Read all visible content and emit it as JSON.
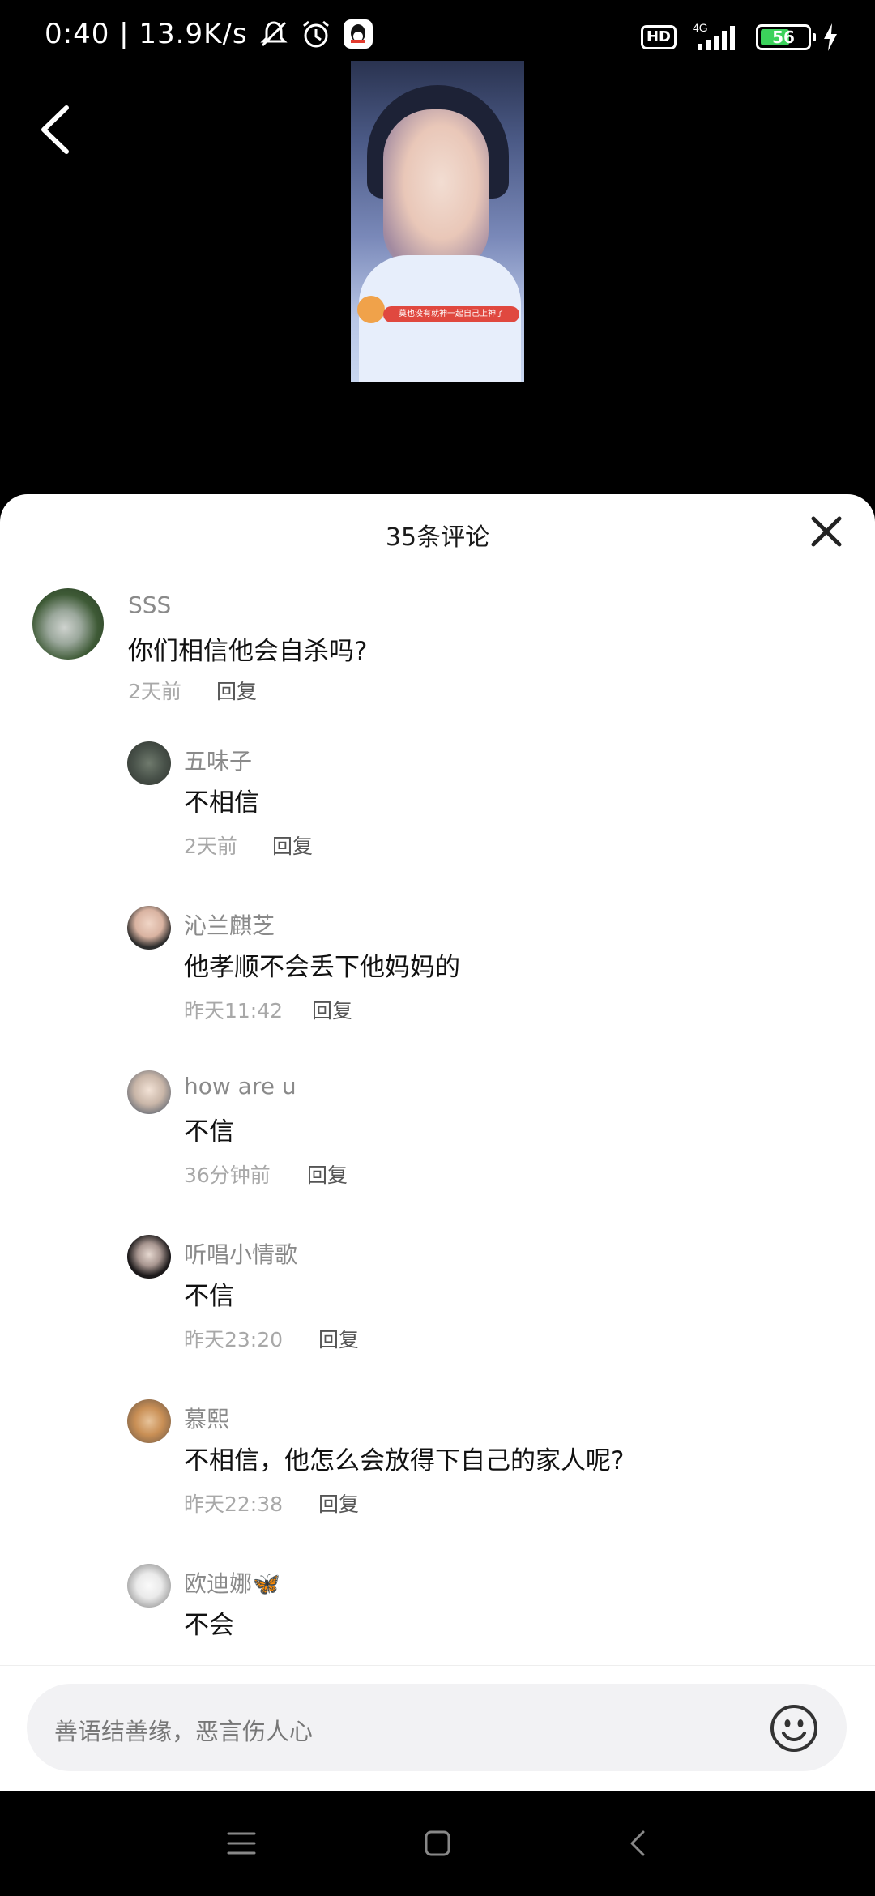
{
  "status_bar": {
    "time_speed": "0:40 | 13.9K/s",
    "hd": "HD",
    "network": "4G",
    "battery": "56"
  },
  "video": {
    "caption": "莫也没有就神一起自己上神了"
  },
  "sheet": {
    "title": "35条评论",
    "reply_label": "回复"
  },
  "comments": [
    {
      "user": "SSS",
      "text": "你们相信他会自杀吗?",
      "time": "2天前",
      "reply": "回复"
    },
    {
      "user": "五味子",
      "text": "不相信",
      "time": "2天前",
      "reply": "回复"
    },
    {
      "user": "沁兰麒芝",
      "text": "他孝顺不会丢下他妈妈的",
      "time": "昨天11:42",
      "reply": "回复"
    },
    {
      "user": "how are u",
      "text": "不信",
      "time": "36分钟前",
      "reply": "回复"
    },
    {
      "user": "听唱小情歌",
      "text": "不信",
      "time": "昨天23:20",
      "reply": "回复"
    },
    {
      "user": "慕熙",
      "text": "不相信，他怎么会放得下自己的家人呢?",
      "time": "昨天22:38",
      "reply": "回复"
    },
    {
      "user": "欧迪娜🦋",
      "text": "不会"
    }
  ],
  "input": {
    "placeholder": "善语结善缘，恶言伤人心"
  },
  "colors": {
    "background": "#000000",
    "sheet": "#ffffff",
    "battery_fill": "#3bd25b",
    "input_bg": "#f2f2f4"
  }
}
